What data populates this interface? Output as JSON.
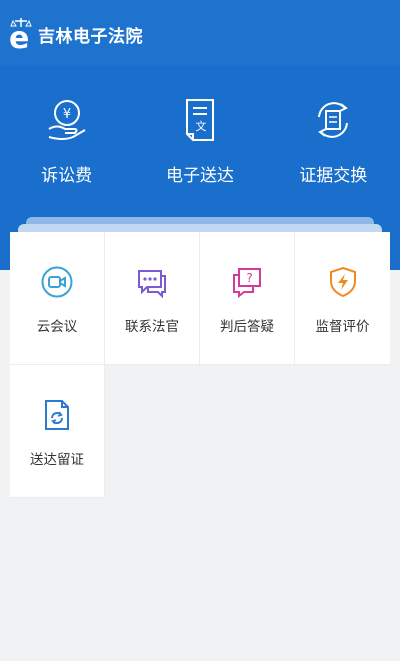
{
  "header": {
    "app_title": "吉林电子法院"
  },
  "features": [
    {
      "label": "诉讼费",
      "icon": "yuan-hand-icon"
    },
    {
      "label": "电子送达",
      "icon": "document-icon"
    },
    {
      "label": "证据交换",
      "icon": "exchange-icon"
    }
  ],
  "services": [
    {
      "label": "云会议",
      "icon": "video-camera-icon",
      "color": "#3aa3d6"
    },
    {
      "label": "联系法官",
      "icon": "chat-bubbles-icon",
      "color": "#7a5bd1"
    },
    {
      "label": "判后答疑",
      "icon": "question-bubble-icon",
      "color": "#d43a9a"
    },
    {
      "label": "监督评价",
      "icon": "shield-bolt-icon",
      "color": "#f08a1e"
    },
    {
      "label": "送达留证",
      "icon": "document-refresh-icon",
      "color": "#2b7ccf"
    }
  ],
  "colors": {
    "brand_blue": "#1e73cf",
    "hero_blue": "#1a6fcd",
    "background": "#f1f2f4"
  }
}
